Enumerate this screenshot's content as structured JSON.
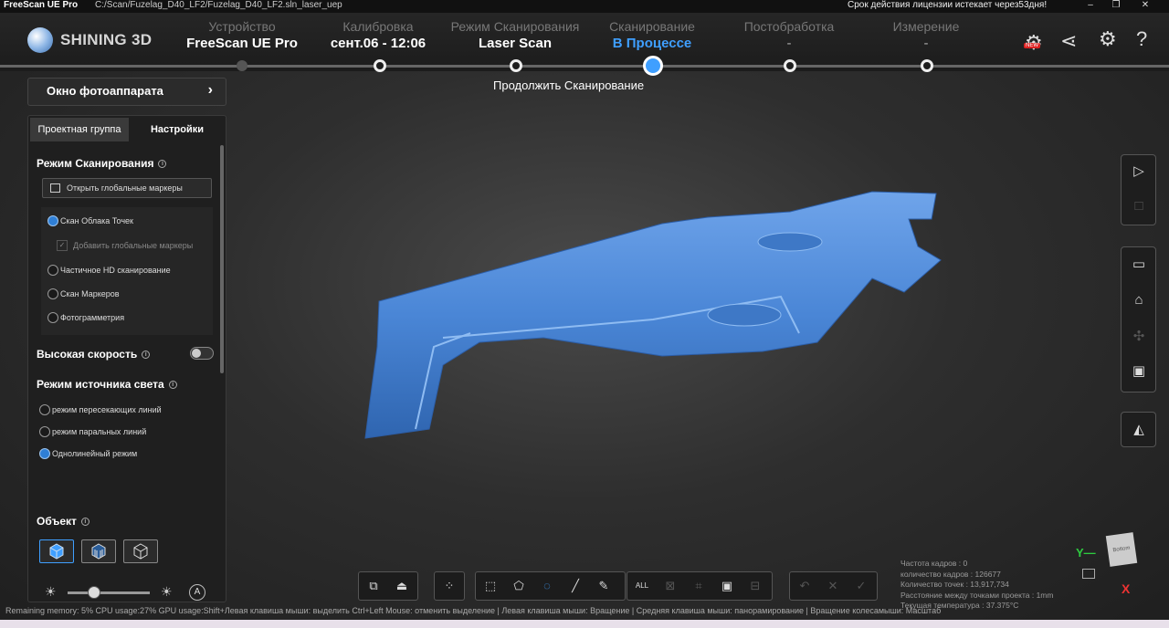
{
  "titlebar": {
    "app": "FreeScan UE Pro",
    "path": "C:/Scan/Fuzelag_D40_LF2/Fuzelag_D40_LF2.sln_laser_uep",
    "license": "Срок действия лицензии истекает через53дня!"
  },
  "header": {
    "logo": "SHINING 3D",
    "steps": [
      {
        "label": "Устройство",
        "value": "FreeScan UE Pro"
      },
      {
        "label": "Калибровка",
        "value": "сент.06 - 12:06"
      },
      {
        "label": "Режим Сканирования",
        "value": "Laser Scan"
      },
      {
        "label": "Сканирование",
        "value": "В Процессе"
      },
      {
        "label": "Постобработка",
        "value": "-"
      },
      {
        "label": "Измерение",
        "value": "-"
      }
    ],
    "new_badge": "NEW",
    "continue_label": "Продолжить Сканирование"
  },
  "left": {
    "camera_window": "Окно фотоаппарата",
    "tabs": [
      "Проектная группа",
      "Настройки"
    ],
    "scan_mode_title": "Режим Сканирования",
    "open_global_markers": "Открыть глобальные маркеры",
    "modes": [
      {
        "label": "Скан Облака Точек",
        "selected": true
      },
      {
        "label": "Частичное HD сканирование",
        "selected": false
      },
      {
        "label": "Скан Маркеров",
        "selected": false
      },
      {
        "label": "Фотограмметрия",
        "selected": false
      }
    ],
    "add_global_markers": "Добавить глобальные маркеры",
    "high_speed": "Высокая скорость",
    "light_mode_title": "Режим источника света",
    "light_modes": [
      {
        "label": "режим пересекающих линий",
        "selected": false
      },
      {
        "label": "режим паральных линий",
        "selected": false
      },
      {
        "label": "Однолинейный режим",
        "selected": true
      }
    ],
    "object_title": "Объект",
    "auto_label": "A"
  },
  "stats": {
    "lines": [
      "Частота кадров : 0",
      "количество кадров : 126677",
      "Количество точек : 13,917,734",
      "Расстояние между точками проекта : 1mm",
      "Текущая температура : 37.375°C"
    ]
  },
  "status_bar": "Remaining memory: 5%  CPU usage:27%  GPU usage:Shift+Левая клавиша мыши: выделить Ctrl+Left Mouse: отменить выделение | Левая клавиша мыши: Вращение | Средняя клавиша мыши: панорамирование | Вращение колесамыши: Масштаб",
  "viewport": {
    "axis_y": "Y",
    "axis_x": "X",
    "cube_face": "Bottom"
  },
  "colors": {
    "accent": "#3f9fff",
    "scan_surface": "#4a86d6"
  }
}
